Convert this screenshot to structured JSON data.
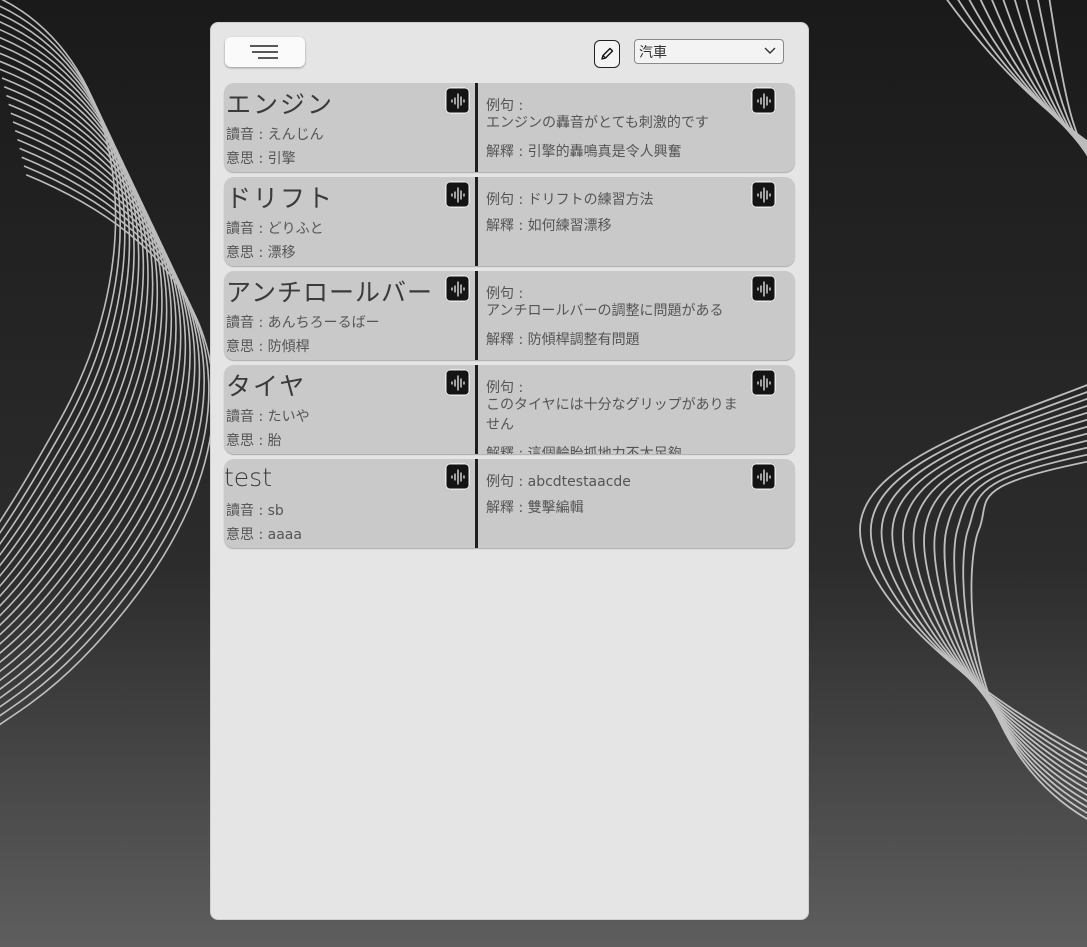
{
  "header": {
    "menu_icon": "hamburger-icon",
    "edit_icon": "pencil-icon",
    "category": "汽車",
    "dropdown_icon": "chevron-down-icon"
  },
  "colors": {
    "panel": "#e5e5e5",
    "card": "#c9c9c9",
    "divider": "#1e1e1e",
    "audio_button": "#141414"
  },
  "cards": [
    {
      "word": "エンジン",
      "reading": "讀音 : えんじん",
      "meaning": "意思 : 引擎",
      "example_label": "例句 :",
      "example": "エンジンの轟音がとても刺激的です",
      "explanation": "解釋 : 引擎的轟鳴真是令人興奮"
    },
    {
      "word": "ドリフト",
      "reading": "讀音 : どりふと",
      "meaning": "意思 : 漂移",
      "example_label": "例句 : ドリフトの練習方法",
      "example": "",
      "explanation": "解釋 : 如何練習漂移"
    },
    {
      "word": "アンチロールバー",
      "reading": "讀音 : あんちろーるばー",
      "meaning": "意思 : 防傾桿",
      "example_label": "例句 :",
      "example": "アンチロールバーの調整に問題がある",
      "explanation": "解釋 : 防傾桿調整有問題"
    },
    {
      "word": "タイヤ",
      "reading": "讀音 : たいや",
      "meaning": "意思 : 胎",
      "example_label": "例句 :",
      "example": "このタイヤには十分なグリップがありません",
      "explanation": "解釋 : 這個輪胎抓地力不太足夠"
    },
    {
      "word": "test",
      "reading": "讀音 : sb",
      "meaning": "意思 : aaaa",
      "example_label": "例句 : abcdtestaacde",
      "example": "",
      "explanation": "解釋 : 雙擊編輯"
    }
  ],
  "audio_icon": "sound-wave-icon"
}
